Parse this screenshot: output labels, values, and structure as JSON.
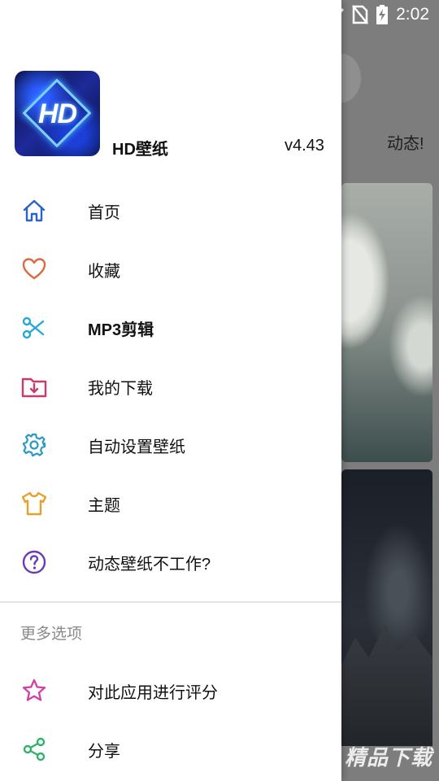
{
  "status_bar": {
    "time": "2:02",
    "icons": [
      "wifi-icon",
      "no-sim-icon",
      "battery-charging-icon"
    ]
  },
  "background": {
    "tab_label": "动态!"
  },
  "drawer": {
    "app_name": "HD壁纸",
    "version": "v4.43",
    "logo_text": "HD",
    "menu": [
      {
        "label": "首页",
        "icon": "home-icon",
        "color": "#2b63c9"
      },
      {
        "label": "收藏",
        "icon": "heart-icon",
        "color": "#d96a42"
      },
      {
        "label": "MP3剪辑",
        "icon": "scissors-icon",
        "color": "#27a8d8"
      },
      {
        "label": "我的下载",
        "icon": "download-folder-icon",
        "color": "#c93a6a"
      },
      {
        "label": "自动设置壁纸",
        "icon": "gear-icon",
        "color": "#2a9bc0"
      },
      {
        "label": "主题",
        "icon": "shirt-icon",
        "color": "#e6a12c"
      },
      {
        "label": "动态壁纸不工作?",
        "icon": "question-icon",
        "color": "#6a3ab8"
      }
    ],
    "section_title": "更多选项",
    "more_menu": [
      {
        "label": "对此应用进行评分",
        "icon": "star-icon",
        "color": "#d13fa8"
      },
      {
        "label": "分享",
        "icon": "share-icon",
        "color": "#2fb368"
      }
    ]
  },
  "watermark": {
    "text": "精品下载"
  }
}
